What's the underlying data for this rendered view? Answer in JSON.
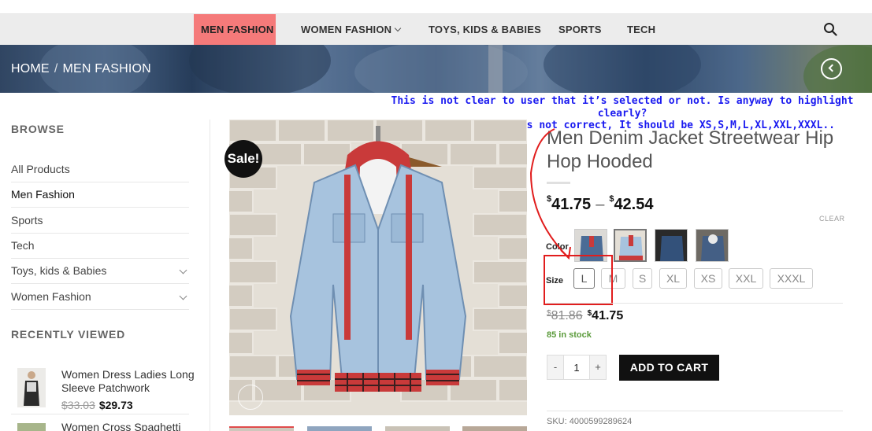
{
  "nav": {
    "items": [
      "MEN FASHION",
      "WOMEN FASHION",
      "TOYS, KIDS & BABIES",
      "SPORTS",
      "TECH"
    ],
    "active": "MEN FASHION",
    "search_icon": "search-icon"
  },
  "hero": {
    "breadcrumb": [
      "HOME",
      "/",
      "MEN FASHION"
    ],
    "nav_icon": "chevron-left-icon"
  },
  "annotation": {
    "line1": "This is not clear to user that it’s selected or not. Is anyway to highlight clearly?",
    "line2": "Also Size Sorting is not correct, It should be XS,S,M,L,XL,XXL,XXXL..",
    "color": "#1a1af0",
    "highlight_color": "#e11d1d"
  },
  "sidebar": {
    "browse_title": "BROWSE",
    "links": [
      "All Products",
      "Men Fashion",
      "Sports",
      "Tech",
      "Toys, kids & Babies",
      "Women Fashion"
    ],
    "recent_title": "RECENTLY VIEWED",
    "recent": [
      {
        "title": "Women Dress Ladies Long Sleeve Patchwork",
        "old_price": "$33.03",
        "new_price": "$29.73"
      },
      {
        "title": "Women Cross Spaghetti"
      }
    ]
  },
  "product": {
    "sale_badge": "Sale!",
    "title": "Men Denim Jacket Streetwear Hip Hop Hooded",
    "price_min_symbol": "$",
    "price_min": "41.75",
    "price_sep": "–",
    "price_max_symbol": "$",
    "price_max": "42.54",
    "clear_label": "CLEAR",
    "color_label": "Color",
    "size_label": "Size",
    "sizes": [
      "L",
      "M",
      "S",
      "XL",
      "XS",
      "XXL",
      "XXXL"
    ],
    "selected_size": "L",
    "old_price_symbol": "$",
    "old_price": "81.86",
    "new_price_symbol": "$",
    "new_price": "41.75",
    "stock": "85 in stock",
    "qty_minus": "-",
    "qty_value": "1",
    "qty_plus": "+",
    "add_to_cart": "ADD TO CART",
    "sku": "SKU: 4000599289624",
    "accent_nav": "#f57a7a",
    "stock_color": "#5a9a3a"
  }
}
